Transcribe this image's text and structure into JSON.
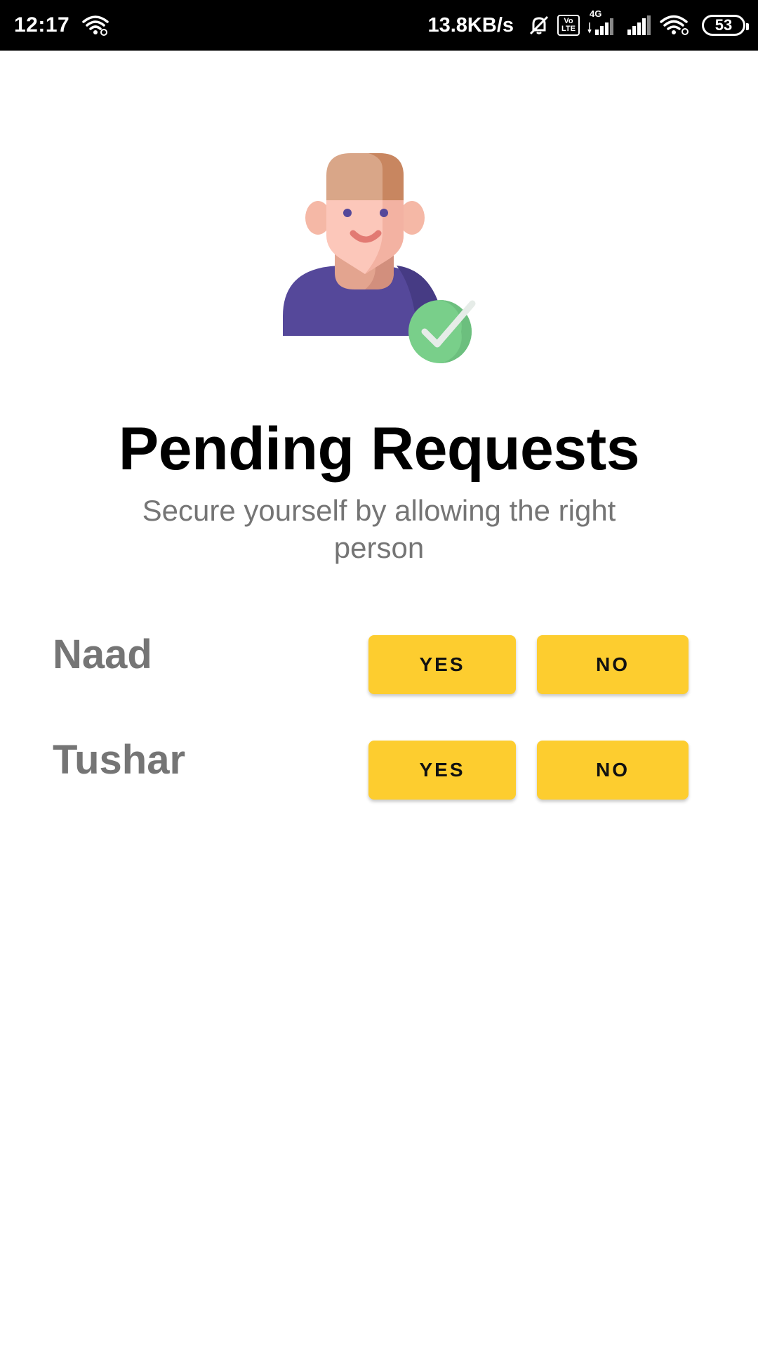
{
  "status_bar": {
    "time": "12:17",
    "network_speed": "13.8KB/s",
    "volte_top": "Vo",
    "volte_bottom": "LTE",
    "network_type": "4G",
    "battery_level": "53"
  },
  "header": {
    "title": "Pending Requests",
    "subtitle": "Secure yourself by allowing the right person"
  },
  "illustration": {
    "icon": "verified-user-icon"
  },
  "requests": [
    {
      "name": "Naad",
      "yes_label": "YES",
      "no_label": "NO"
    },
    {
      "name": "Tushar",
      "yes_label": "YES",
      "no_label": "NO"
    }
  ],
  "colors": {
    "button": "#fdcd2f",
    "name_text": "#757575",
    "title_text": "#000000",
    "status_bar": "#000000"
  }
}
